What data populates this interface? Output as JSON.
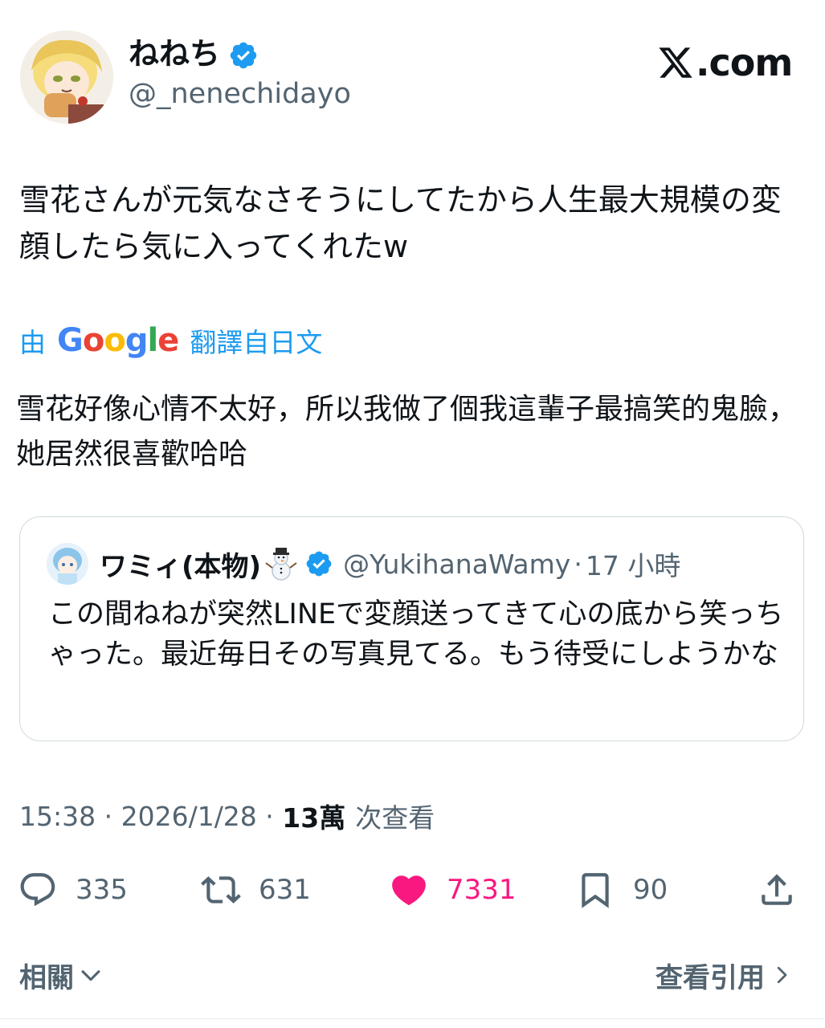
{
  "author": {
    "name": "ねねち",
    "handle": "@_nenechidayo",
    "verified": true
  },
  "brand": {
    "text": ".com"
  },
  "tweet": {
    "text": "雪花さんが元気なさそうにしてたから人生最大規模の変顔したら気に入ってくれたw",
    "translation_prefix": "由",
    "translation_provider": "Google",
    "translation_suffix": "翻譯自日文",
    "translated_text": "雪花好像心情不太好，所以我做了個我這輩子最搞笑的鬼臉，她居然很喜歡哈哈"
  },
  "quote": {
    "name": "ワミィ(本物)",
    "handle": "@YukihanaWamy",
    "separator": "·",
    "time": "17 小時",
    "text": "この間ねねが突然LINEで変顔送ってきて心の底から笑っちゃった。最近毎日その写真見てる。もう待受にしようかな"
  },
  "meta": {
    "time": "15:38",
    "sep1": " · ",
    "date": "2026/1/28",
    "sep2": " · ",
    "views": "13萬",
    "views_label": "次查看"
  },
  "actions": {
    "replies": "335",
    "reposts": "631",
    "likes": "7331",
    "bookmarks": "90"
  },
  "footer": {
    "related_label": "相關",
    "view_quotes_label": "查看引用"
  },
  "colors": {
    "accent": "#1d9bf0",
    "like": "#f91880",
    "secondary_text": "#536471"
  }
}
